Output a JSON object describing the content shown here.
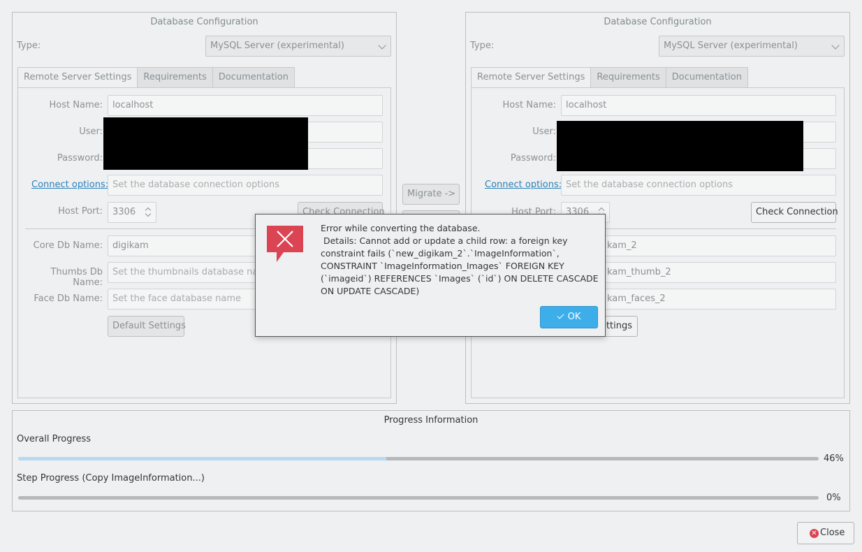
{
  "left_panel": {
    "title": "Database Configuration",
    "type_label": "Type:",
    "type_value": "MySQL Server (experimental)",
    "tabs": [
      "Remote Server Settings",
      "Requirements",
      "Documentation"
    ],
    "host_name_label": "Host Name:",
    "host_name_value": "localhost",
    "user_label": "User:",
    "password_label": "Password:",
    "connect_options_label": "Connect options:",
    "connect_options_placeholder": "Set the database connection options",
    "host_port_label": "Host Port:",
    "host_port_value": "3306",
    "check_connection_label": "Check Connection",
    "core_db_label": "Core Db Name:",
    "core_db_value": "digikam",
    "thumbs_db_label": "Thumbs Db Name:",
    "thumbs_db_placeholder": "Set the thumbnails database name",
    "face_db_label": "Face Db Name:",
    "face_db_placeholder": "Set the face database name",
    "default_settings_label": "Default Settings"
  },
  "right_panel": {
    "title": "Database Configuration",
    "type_label": "Type:",
    "type_value": "MySQL Server (experimental)",
    "tabs": [
      "Remote Server Settings",
      "Requirements",
      "Documentation"
    ],
    "host_name_label": "Host Name:",
    "host_name_value": "localhost",
    "user_label": "User:",
    "password_label": "Password:",
    "connect_options_label": "Connect options:",
    "connect_options_placeholder": "Set the database connection options",
    "host_port_label": "Host Port:",
    "host_port_value": "3306",
    "check_connection_label": "Check Connection",
    "core_db_value_partial": "kam_2",
    "thumbs_db_value_partial": "kam_thumb_2",
    "face_db_value_partial": "kam_faces_2",
    "default_settings_partial": "ettings"
  },
  "migrate_button_label": "Migrate ->",
  "progress": {
    "title": "Progress Information",
    "overall_label": "Overall Progress",
    "overall_percent_text": "46%",
    "overall_fraction": 0.46,
    "step_label": "Step Progress (Copy ImageInformation...)",
    "step_percent_text": "0%",
    "step_fraction": 0.0
  },
  "dialog": {
    "message_line1": "Error while converting the database.",
    "message_details": " Details: Cannot add or update a child row: a foreign key constraint fails (`new_digikam_2`.`ImageInformation`, CONSTRAINT `ImageInformation_Images` FOREIGN KEY (`imageid`) REFERENCES `Images` (`id`) ON DELETE CASCADE ON UPDATE CASCADE)",
    "ok_label": "OK",
    "ok_icon": "checkmark-icon",
    "error_icon": "error-icon"
  },
  "close_button_label": "Close",
  "colors": {
    "accent": "#3daee9",
    "error_red": "#da4453",
    "progress_fill": "#b8d9ef",
    "link": "#2980b9"
  }
}
